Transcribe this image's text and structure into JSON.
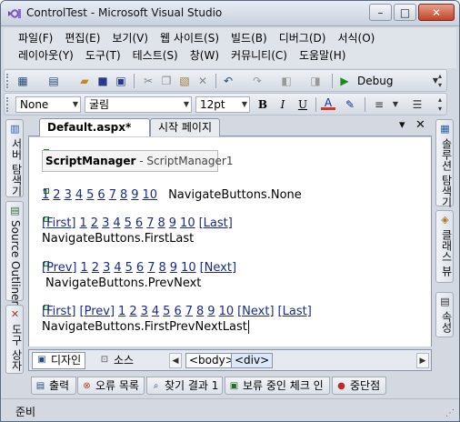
{
  "window": {
    "title": "ControlTest - Microsoft Visual Studio",
    "min_glyph": "–",
    "max_glyph": "□",
    "close_glyph": "✕"
  },
  "menu": {
    "row1": [
      "파일(F)",
      "편집(E)",
      "보기(V)",
      "웹 사이트(S)",
      "빌드(B)",
      "디버그(D)",
      "서식(O)"
    ],
    "row2": [
      "레이아웃(Y)",
      "도구(T)",
      "테스트(S)",
      "창(W)",
      "커뮤니티(C)",
      "도움말(H)"
    ]
  },
  "toolbar1": {
    "config": "Debug"
  },
  "toolbar2": {
    "block_format": "None",
    "font_name": "굴림",
    "font_size": "12pt",
    "bold": "B",
    "italic": "I",
    "underline": "U"
  },
  "left_panel": {
    "tabs": [
      "서버 탐색기",
      "Source Outliner",
      "도구 상자"
    ]
  },
  "right_panel": {
    "tabs": [
      "솔루션 탐색기",
      "클래스 뷰",
      "속성"
    ]
  },
  "doc_tabs": {
    "active": "Default.aspx*",
    "inactive": "시작 페이지",
    "dropdown": "▾",
    "close": "✕"
  },
  "editor": {
    "script_manager": {
      "type": "ScriptManager",
      "id": "- ScriptManager1"
    },
    "pagers": [
      {
        "links": [
          "1",
          "2",
          "3",
          "4",
          "5",
          "6",
          "7",
          "8",
          "9",
          "10"
        ],
        "caption": "NavigateButtons.None"
      },
      {
        "links": [
          "[First]",
          "1",
          "2",
          "3",
          "4",
          "5",
          "6",
          "7",
          "8",
          "9",
          "10",
          "[Last]"
        ],
        "caption": "NavigateButtons.FirstLast"
      },
      {
        "links": [
          "[Prev]",
          "1",
          "2",
          "3",
          "4",
          "5",
          "6",
          "7",
          "8",
          "9",
          "10",
          "[Next]"
        ],
        "caption": "NavigateButtons.PrevNext"
      },
      {
        "links": [
          "[First]",
          "[Prev]",
          "1",
          "2",
          "3",
          "4",
          "5",
          "6",
          "7",
          "8",
          "9",
          "10",
          "[Next]",
          "[Last]"
        ],
        "caption": "NavigateButtons.FirstPrevNextLast"
      }
    ]
  },
  "designer_bar": {
    "design": "디자인",
    "source": "소스",
    "crumbs": [
      "<body>",
      "<div>"
    ],
    "prev": "◀",
    "next": "▶"
  },
  "tool_tabs": [
    "출력",
    "오류 목록",
    "찾기 결과 1",
    "보류 중인 체크 인",
    "중단점"
  ],
  "status": {
    "text": "준비"
  },
  "icons": {
    "app": "vs-infinity-icon",
    "accent": "#1a2a8a"
  }
}
